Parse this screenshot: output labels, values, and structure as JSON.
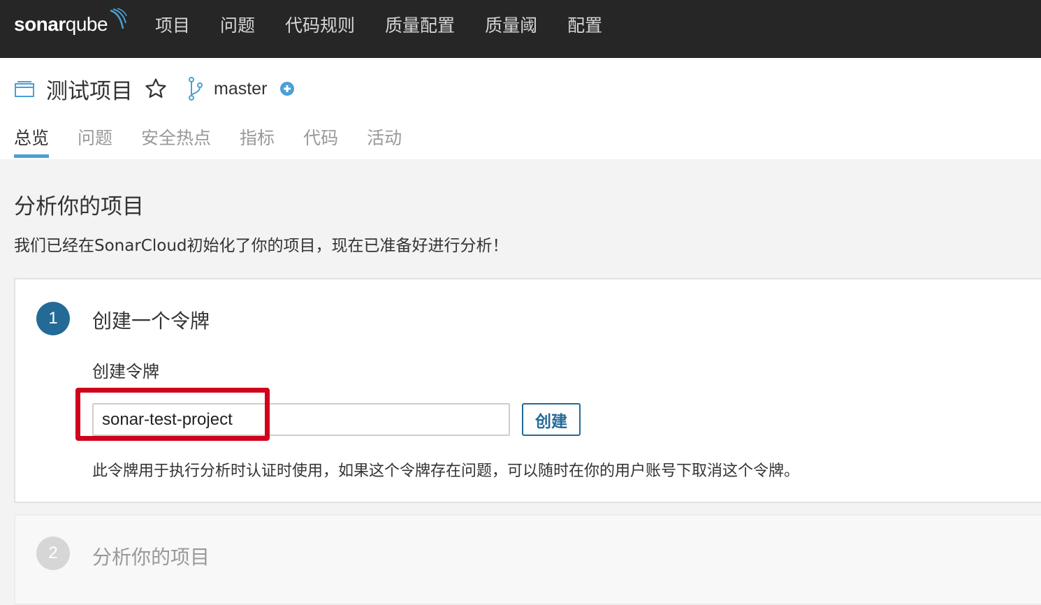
{
  "topnav": {
    "logo_sonar": "sonar",
    "logo_qube": "qube",
    "items": [
      "项目",
      "问题",
      "代码规则",
      "质量配置",
      "质量阈",
      "配置"
    ]
  },
  "project": {
    "name": "测试项目",
    "branch": "master",
    "tabs": [
      "总览",
      "问题",
      "安全热点",
      "指标",
      "代码",
      "活动"
    ],
    "active_tab": "总览"
  },
  "main": {
    "title": "分析你的项目",
    "subtitle": "我们已经在SonarCloud初始化了你的项目，现在已准备好进行分析！"
  },
  "step1": {
    "number": "1",
    "title": "创建一个令牌",
    "token_label": "创建令牌",
    "token_value": "sonar-test-project",
    "create_button": "创建",
    "help_text": "此令牌用于执行分析时认证时使用，如果这个令牌存在问题，可以随时在你的用户账号下取消这个令牌。"
  },
  "step2": {
    "number": "2",
    "title": "分析你的项目"
  },
  "colors": {
    "topnav_bg": "#262626",
    "accent_blue": "#236a97",
    "tab_underline": "#4b9fd5",
    "highlight_red": "#d0021b"
  }
}
